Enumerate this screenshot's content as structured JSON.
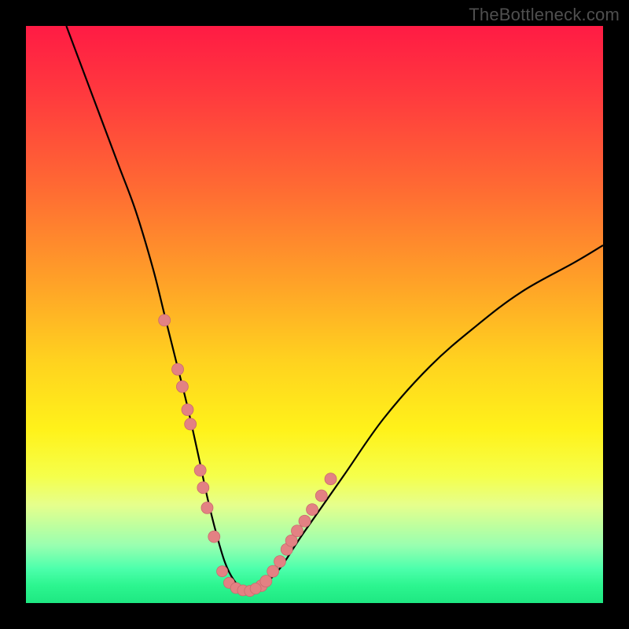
{
  "watermark": "TheBottleneck.com",
  "chart_data": {
    "type": "line",
    "title": "",
    "xlabel": "",
    "ylabel": "",
    "xlim": [
      0,
      100
    ],
    "ylim": [
      0,
      100
    ],
    "grid": false,
    "series": [
      {
        "name": "bottleneck-curve",
        "x": [
          7,
          10,
          13,
          16,
          19,
          22,
          24,
          26,
          28,
          30,
          31.5,
          33,
          34.5,
          36,
          37.5,
          39,
          41,
          44,
          48,
          55,
          62,
          70,
          78,
          86,
          95,
          100
        ],
        "y": [
          100,
          92,
          84,
          76,
          68,
          58,
          50,
          42,
          34,
          25,
          18,
          12,
          7,
          4,
          2.5,
          2,
          3,
          6,
          12,
          22,
          32,
          41,
          48,
          54,
          59,
          62
        ]
      }
    ],
    "markers_left": {
      "name": "left-branch-points",
      "x": [
        24.0,
        26.3,
        27.1,
        28.0,
        28.5,
        30.2,
        30.7,
        31.4,
        32.6
      ],
      "y": [
        49.0,
        40.5,
        37.5,
        33.5,
        31.0,
        23.0,
        20.0,
        16.5,
        11.5
      ]
    },
    "markers_right": {
      "name": "right-branch-points",
      "x": [
        40.8,
        41.6,
        42.8,
        44.0,
        45.2,
        46.0,
        47.0,
        48.3,
        49.6,
        51.2,
        52.8
      ],
      "y": [
        3.0,
        3.8,
        5.5,
        7.2,
        9.3,
        10.8,
        12.5,
        14.2,
        16.2,
        18.6,
        21.5
      ]
    },
    "markers_bottom": {
      "name": "valley-points",
      "x": [
        34.0,
        35.2,
        36.4,
        37.6,
        38.8,
        39.8
      ],
      "y": [
        5.5,
        3.5,
        2.6,
        2.2,
        2.1,
        2.5
      ]
    },
    "colors": {
      "curve": "#000000",
      "marker_fill": "#e38183",
      "marker_stroke": "#c96b6e"
    }
  }
}
